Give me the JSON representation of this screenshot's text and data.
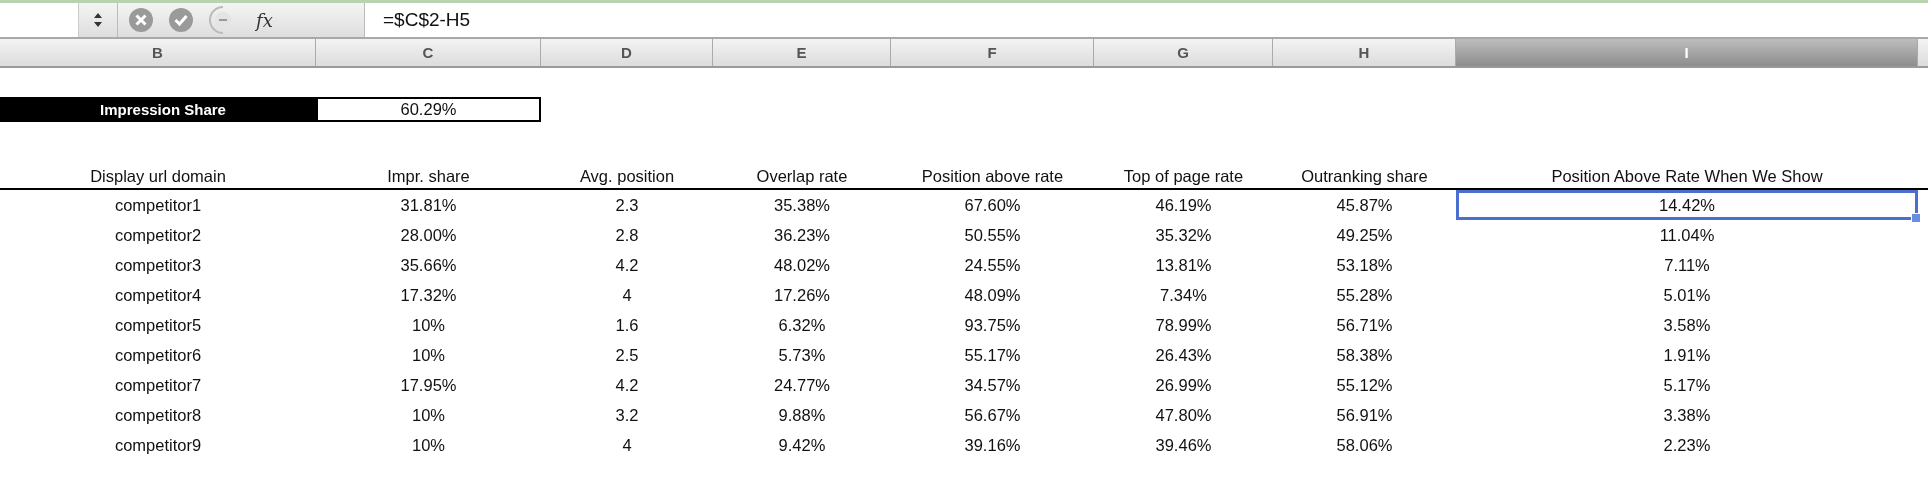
{
  "formula_bar": {
    "fx_label": "fx",
    "formula": "=$C$2-H5"
  },
  "column_headers": [
    {
      "label": "B",
      "selected": false
    },
    {
      "label": "C",
      "selected": false
    },
    {
      "label": "D",
      "selected": false
    },
    {
      "label": "E",
      "selected": false
    },
    {
      "label": "F",
      "selected": false
    },
    {
      "label": "G",
      "selected": false
    },
    {
      "label": "H",
      "selected": false
    },
    {
      "label": "I",
      "selected": true
    }
  ],
  "summary": {
    "label": "Impression Share",
    "value": "60.29%"
  },
  "table": {
    "columns": [
      "Display url domain",
      "Impr. share",
      "Avg. position",
      "Overlap rate",
      "Position above rate",
      "Top of page rate",
      "Outranking share",
      "Position Above Rate When We Show"
    ],
    "rows": [
      {
        "cells": [
          {
            "text": "competitor1",
            "selected": false
          },
          {
            "text": "31.81%",
            "selected": false
          },
          {
            "text": "2.3",
            "selected": false
          },
          {
            "text": "35.38%",
            "selected": false
          },
          {
            "text": "67.60%",
            "selected": false
          },
          {
            "text": "46.19%",
            "selected": false
          },
          {
            "text": "45.87%",
            "selected": false
          },
          {
            "text": "14.42%",
            "selected": true
          }
        ]
      },
      {
        "cells": [
          {
            "text": "competitor2",
            "selected": false
          },
          {
            "text": "28.00%",
            "selected": false
          },
          {
            "text": "2.8",
            "selected": false
          },
          {
            "text": "36.23%",
            "selected": false
          },
          {
            "text": "50.55%",
            "selected": false
          },
          {
            "text": "35.32%",
            "selected": false
          },
          {
            "text": "49.25%",
            "selected": false
          },
          {
            "text": "11.04%",
            "selected": false
          }
        ]
      },
      {
        "cells": [
          {
            "text": "competitor3",
            "selected": false
          },
          {
            "text": "35.66%",
            "selected": false
          },
          {
            "text": "4.2",
            "selected": false
          },
          {
            "text": "48.02%",
            "selected": false
          },
          {
            "text": "24.55%",
            "selected": false
          },
          {
            "text": "13.81%",
            "selected": false
          },
          {
            "text": "53.18%",
            "selected": false
          },
          {
            "text": "7.11%",
            "selected": false
          }
        ]
      },
      {
        "cells": [
          {
            "text": "competitor4",
            "selected": false
          },
          {
            "text": "17.32%",
            "selected": false
          },
          {
            "text": "4",
            "selected": false
          },
          {
            "text": "17.26%",
            "selected": false
          },
          {
            "text": "48.09%",
            "selected": false
          },
          {
            "text": "7.34%",
            "selected": false
          },
          {
            "text": "55.28%",
            "selected": false
          },
          {
            "text": "5.01%",
            "selected": false
          }
        ]
      },
      {
        "cells": [
          {
            "text": "competitor5",
            "selected": false
          },
          {
            "text": "10%",
            "selected": false
          },
          {
            "text": "1.6",
            "selected": false
          },
          {
            "text": "6.32%",
            "selected": false
          },
          {
            "text": "93.75%",
            "selected": false
          },
          {
            "text": "78.99%",
            "selected": false
          },
          {
            "text": "56.71%",
            "selected": false
          },
          {
            "text": "3.58%",
            "selected": false
          }
        ]
      },
      {
        "cells": [
          {
            "text": "competitor6",
            "selected": false
          },
          {
            "text": "10%",
            "selected": false
          },
          {
            "text": "2.5",
            "selected": false
          },
          {
            "text": "5.73%",
            "selected": false
          },
          {
            "text": "55.17%",
            "selected": false
          },
          {
            "text": "26.43%",
            "selected": false
          },
          {
            "text": "58.38%",
            "selected": false
          },
          {
            "text": "1.91%",
            "selected": false
          }
        ]
      },
      {
        "cells": [
          {
            "text": "competitor7",
            "selected": false
          },
          {
            "text": "17.95%",
            "selected": false
          },
          {
            "text": "4.2",
            "selected": false
          },
          {
            "text": "24.77%",
            "selected": false
          },
          {
            "text": "34.57%",
            "selected": false
          },
          {
            "text": "26.99%",
            "selected": false
          },
          {
            "text": "55.12%",
            "selected": false
          },
          {
            "text": "5.17%",
            "selected": false
          }
        ]
      },
      {
        "cells": [
          {
            "text": "competitor8",
            "selected": false
          },
          {
            "text": "10%",
            "selected": false
          },
          {
            "text": "3.2",
            "selected": false
          },
          {
            "text": "9.88%",
            "selected": false
          },
          {
            "text": "56.67%",
            "selected": false
          },
          {
            "text": "47.80%",
            "selected": false
          },
          {
            "text": "56.91%",
            "selected": false
          },
          {
            "text": "3.38%",
            "selected": false
          }
        ]
      },
      {
        "cells": [
          {
            "text": "competitor9",
            "selected": false
          },
          {
            "text": "10%",
            "selected": false
          },
          {
            "text": "4",
            "selected": false
          },
          {
            "text": "9.42%",
            "selected": false
          },
          {
            "text": "39.16%",
            "selected": false
          },
          {
            "text": "39.46%",
            "selected": false
          },
          {
            "text": "58.06%",
            "selected": false
          },
          {
            "text": "2.23%",
            "selected": false
          }
        ]
      }
    ]
  }
}
